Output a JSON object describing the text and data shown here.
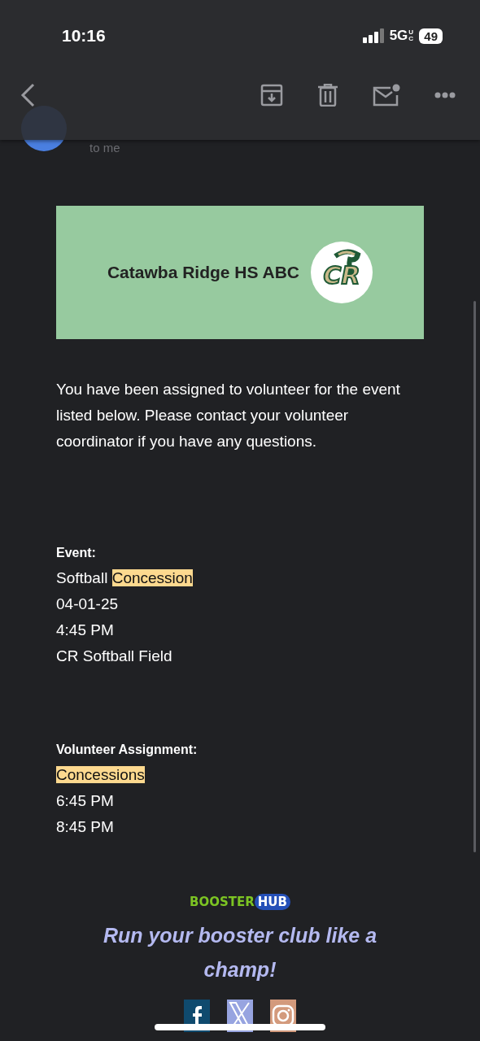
{
  "status_bar": {
    "time": "10:16",
    "network": "5G",
    "network_sup": "UC",
    "battery": "49"
  },
  "email": {
    "recipient": "to me"
  },
  "banner": {
    "title": "Catawba Ridge HS ABC",
    "logo_text": "CR"
  },
  "intro": "You have been assigned to volunteer for the event listed below. Please contact your volunteer coordinator if you have any questions.",
  "sections": [
    {
      "heading": "Event:",
      "lines": [
        [
          {
            "text": "Softball ",
            "highlighted": false
          },
          {
            "text": "Concession",
            "highlighted": true
          }
        ],
        [
          {
            "text": "04-01-25",
            "highlighted": false
          }
        ],
        [
          {
            "text": "4:45 PM",
            "highlighted": false
          }
        ],
        [
          {
            "text": "CR Softball Field",
            "highlighted": false
          }
        ]
      ]
    },
    {
      "heading": "Volunteer Assignment:",
      "lines": [
        [
          {
            "text": "Concessions",
            "highlighted": true
          }
        ],
        [
          {
            "text": "6:45 PM",
            "highlighted": false
          }
        ],
        [
          {
            "text": "8:45 PM",
            "highlighted": false
          }
        ]
      ]
    }
  ],
  "footer": {
    "brand_left": "BOOSTER",
    "brand_right": "HUB",
    "tagline": "Run your booster club like a champ!",
    "social": [
      {
        "kind": "facebook"
      },
      {
        "kind": "x"
      },
      {
        "kind": "instagram"
      }
    ]
  }
}
